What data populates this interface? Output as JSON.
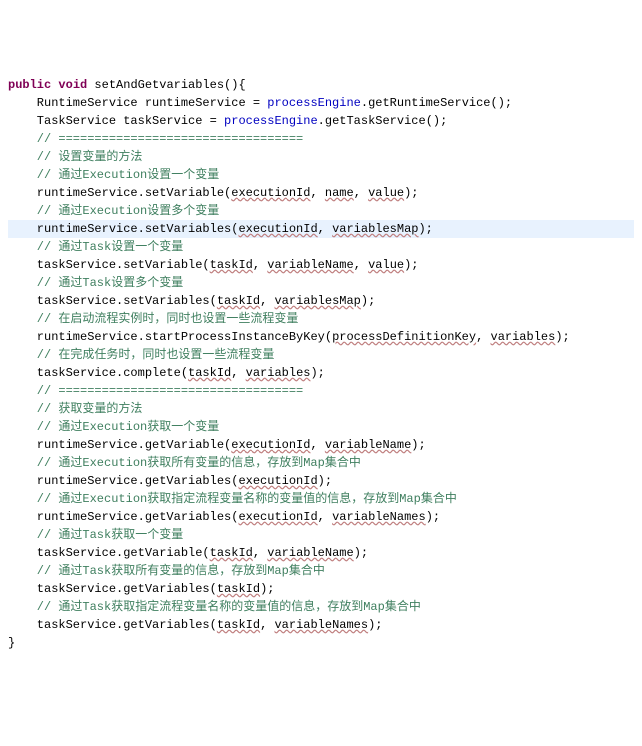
{
  "code": {
    "l1_kw1": "public",
    "l1_kw2": "void",
    "l1_sig": " setAndGetvariables(){",
    "l2a": "    RuntimeService runtimeService = ",
    "l2b": "processEngine",
    "l2c": ".getRuntimeService();",
    "l3a": "    TaskService taskService = ",
    "l3b": "processEngine",
    "l3c": ".getTaskService();",
    "l4": "    // ==================================",
    "l5": "    // 设置变量的方法",
    "l6": "    // 通过Execution设置一个变量",
    "l7a": "    runtimeService.setVariable(",
    "l7b": "executionId",
    "l7c": ", ",
    "l7d": "name",
    "l7e": ", ",
    "l7f": "value",
    "l7g": ");",
    "l8": "    // 通过Execution设置多个变量",
    "l9a": "    runtimeService.setVariables(",
    "l9b": "executionId",
    "l9c": ", ",
    "l9d": "variablesMap",
    "l9e": ");",
    "l10": "    // 通过Task设置一个变量",
    "l11a": "    taskService.setVariable(",
    "l11b": "taskId",
    "l11c": ", ",
    "l11d": "variableName",
    "l11e": ", ",
    "l11f": "value",
    "l11g": ");",
    "l12": "    // 通过Task设置多个变量",
    "l13a": "    taskService.setVariables(",
    "l13b": "taskId",
    "l13c": ", ",
    "l13d": "variablesMap",
    "l13e": ");",
    "l14": "    // 在启动流程实例时，同时也设置一些流程变量",
    "l15a": "    runtimeService.startProcessInstanceByKey(",
    "l15b": "processDefinitionKey",
    "l15c": ", ",
    "l15d": "variables",
    "l15e": ");",
    "l16": "    // 在完成任务时，同时也设置一些流程变量",
    "l17a": "    taskService.complete(",
    "l17b": "taskId",
    "l17c": ", ",
    "l17d": "variables",
    "l17e": ");",
    "l18": "    // ==================================",
    "l19": "    // 获取变量的方法",
    "l20": "    // 通过Execution获取一个变量",
    "l21a": "    runtimeService.getVariable(",
    "l21b": "executionId",
    "l21c": ", ",
    "l21d": "variableName",
    "l21e": ");",
    "l22": "    // 通过Execution获取所有变量的信息，存放到Map集合中",
    "l23a": "    runtimeService.getVariables(",
    "l23b": "executionId",
    "l23c": ");",
    "l24": "    // 通过Execution获取指定流程变量名称的变量值的信息，存放到Map集合中",
    "l25a": "    runtimeService.getVariables(",
    "l25b": "executionId",
    "l25c": ", ",
    "l25d": "variableNames",
    "l25e": ");",
    "l26": "",
    "l27": "    // 通过Task获取一个变量",
    "l28a": "    taskService.getVariable(",
    "l28b": "taskId",
    "l28c": ", ",
    "l28d": "variableName",
    "l28e": ");",
    "l29": "    // 通过Task获取所有变量的信息，存放到Map集合中",
    "l30a": "    taskService.getVariables(",
    "l30b": "taskId",
    "l30c": ");",
    "l31": "    // 通过Task获取指定流程变量名称的变量值的信息，存放到Map集合中",
    "l32a": "    taskService.getVariables(",
    "l32b": "taskId",
    "l32c": ", ",
    "l32d": "variableNames",
    "l32e": ");",
    "end": "}"
  }
}
